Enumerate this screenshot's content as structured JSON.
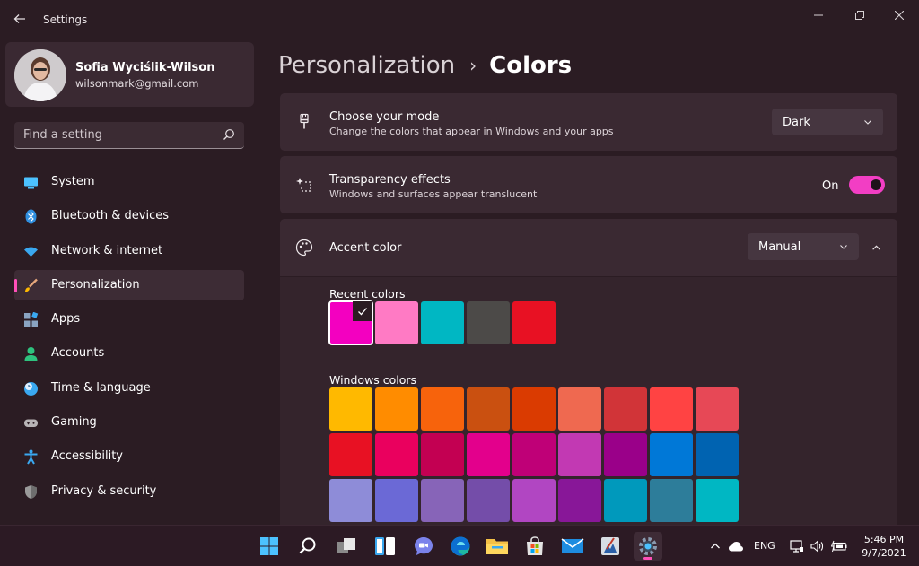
{
  "window": {
    "title": "Settings"
  },
  "profile": {
    "name": "Sofia Wyciślik-Wilson",
    "email": "wilsonmark@gmail.com"
  },
  "search": {
    "placeholder": "Find a setting"
  },
  "sidebar": {
    "items": [
      {
        "label": "System",
        "icon": "system-icon",
        "color": "#4cc2ff"
      },
      {
        "label": "Bluetooth & devices",
        "icon": "bluetooth-icon",
        "color": "#2f8fe0"
      },
      {
        "label": "Network & internet",
        "icon": "wifi-icon",
        "color": "#3aa8f0"
      },
      {
        "label": "Personalization",
        "icon": "paintbrush-icon",
        "color": "#f0a050",
        "active": true
      },
      {
        "label": "Apps",
        "icon": "apps-icon",
        "color": "#7ab4e8"
      },
      {
        "label": "Accounts",
        "icon": "person-icon",
        "color": "#2ec27e"
      },
      {
        "label": "Time & language",
        "icon": "clock-globe-icon",
        "color": "#3aa8f0"
      },
      {
        "label": "Gaming",
        "icon": "gamepad-icon",
        "color": "#b8b4b6"
      },
      {
        "label": "Accessibility",
        "icon": "accessibility-icon",
        "color": "#3aa8f0"
      },
      {
        "label": "Privacy & security",
        "icon": "shield-icon",
        "color": "#9a9a9a"
      }
    ]
  },
  "breadcrumb": {
    "parent": "Personalization",
    "separator": "›",
    "current": "Colors"
  },
  "mode": {
    "title": "Choose your mode",
    "description": "Change the colors that appear in Windows and your apps",
    "value": "Dark"
  },
  "transparency": {
    "title": "Transparency effects",
    "description": "Windows and surfaces appear translucent",
    "state_label": "On",
    "enabled": true
  },
  "accent": {
    "title": "Accent color",
    "value": "Manual",
    "recent_label": "Recent colors",
    "windows_label": "Windows colors",
    "recent_colors": [
      "#f300c0",
      "#ff7ac4",
      "#00b7c3",
      "#4c4a48",
      "#e81123"
    ],
    "selected_recent": 0,
    "windows_colors": [
      [
        "#ffb900",
        "#ff8c00",
        "#f7630c",
        "#ca5010",
        "#da3b01",
        "#ef6950",
        "#d13438",
        "#ff4343",
        "#e74856"
      ],
      [
        "#e81123",
        "#ea005e",
        "#c30052",
        "#e3008c",
        "#bf0077",
        "#c239b3",
        "#9a0089",
        "#0078d7",
        "#0063b1"
      ],
      [
        "#8e8cd8",
        "#6b69d6",
        "#8764b8",
        "#744da9",
        "#b146c2",
        "#881798",
        "#0099bc",
        "#2d7d9a",
        "#00b7c3"
      ]
    ]
  },
  "taskbar": {
    "apps": [
      {
        "name": "start-icon"
      },
      {
        "name": "search-icon"
      },
      {
        "name": "task-view-icon"
      },
      {
        "name": "widgets-icon"
      },
      {
        "name": "teams-chat-icon"
      },
      {
        "name": "edge-icon"
      },
      {
        "name": "file-explorer-icon"
      },
      {
        "name": "store-icon"
      },
      {
        "name": "mail-icon"
      },
      {
        "name": "paint-icon"
      },
      {
        "name": "settings-icon",
        "active": true
      }
    ],
    "language": "ENG",
    "time": "5:46 PM",
    "date": "9/7/2021"
  }
}
